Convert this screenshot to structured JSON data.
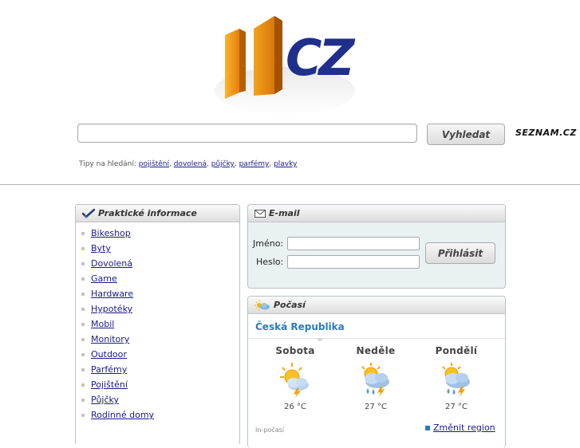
{
  "search": {
    "input_value": "",
    "button_label": "Vyhledat",
    "partner_logo": "SEZNAM.CZ"
  },
  "tips": {
    "label": "Tipy na hledání:",
    "links": [
      "pojištění",
      "dovolená",
      "půjčky",
      "parfémy",
      "plavky"
    ]
  },
  "info_panel": {
    "title": "Praktické informace",
    "items": [
      "Bikeshop",
      "Byty",
      "Dovolená",
      "Game",
      "Hardware",
      "Hypotéky",
      "Mobil",
      "Monitory",
      "Outdoor",
      "Parfémy",
      "Pojištění",
      "Půjčky",
      "Rodinné domy"
    ]
  },
  "email_panel": {
    "title": "E-mail",
    "name_label": "Jméno:",
    "password_label": "Heslo:",
    "login_button": "Přihlásit"
  },
  "weather_panel": {
    "title": "Počasí",
    "region": "Česká Republika",
    "days": [
      {
        "name": "Sobota",
        "temp": "26 °C",
        "icon": "sun-cloud-storm-icon"
      },
      {
        "name": "Neděle",
        "temp": "27 °C",
        "icon": "sun-cloud-rain-storm-icon"
      },
      {
        "name": "Pondělí",
        "temp": "27 °C",
        "icon": "sun-cloud-rain-storm-icon"
      }
    ],
    "source": "In-počasí",
    "change_region_label": "Změnit region"
  },
  "colors": {
    "logo_orange": "#f39a17",
    "logo_navy": "#1e2f8c",
    "link": "#1a1a8c",
    "weather_region": "#2b7bb9",
    "seznam_red": "#d21e1e"
  }
}
